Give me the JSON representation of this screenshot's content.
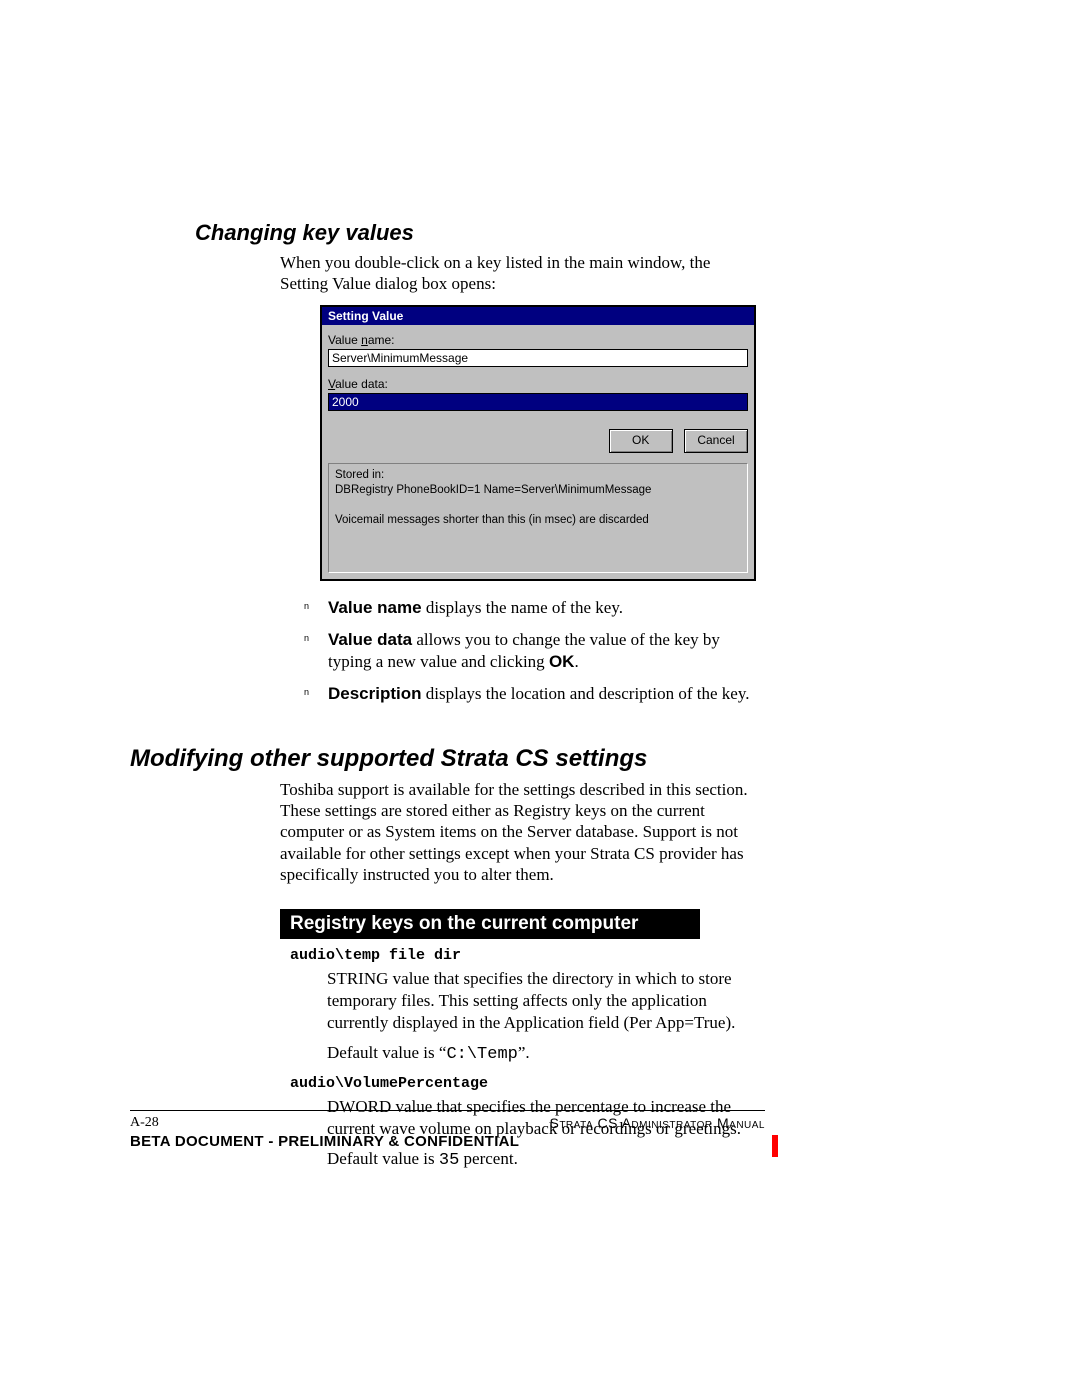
{
  "section1": {
    "heading": "Changing key values",
    "intro": "When you double-click on a key listed in the main window, the Setting Value dialog box opens:"
  },
  "dialog": {
    "title": "Setting Value",
    "value_name_label_pre": "Value ",
    "value_name_label_ul": "n",
    "value_name_label_post": "ame:",
    "value_name": "Server\\MinimumMessage",
    "value_data_label_ul": "V",
    "value_data_label_post": "alue data:",
    "value_data": "2000",
    "ok": "OK",
    "cancel": "Cancel",
    "stored_in_label": "Stored in:",
    "stored_in": "DBRegistry PhoneBookID=1 Name=Server\\MinimumMessage",
    "description": "Voicemail messages shorter than this (in msec) are discarded"
  },
  "bullets": {
    "b1_bold": "Value name",
    "b1_rest": " displays the name of the key.",
    "b2_bold": "Value data",
    "b2_rest1": " allows you to change the value of the key by typing a new value and clicking ",
    "b2_ok": "OK",
    "b2_rest2": ".",
    "b3_bold": "Description",
    "b3_rest": " displays the location and description of the key."
  },
  "section2": {
    "heading": "Modifying other supported Strata CS settings",
    "para": "Toshiba support is available for the settings described in this section. These settings are stored either as Registry keys on the current computer or as System items on the Server database. Support is not available for other settings except when your Strata CS provider has specifically instructed you to alter them."
  },
  "registry": {
    "bar": "Registry keys on the current computer",
    "k1": "audio\\temp file dir",
    "k1_desc": "STRING value that specifies the directory in which to store temporary files. This setting affects only the application currently displayed in the Application field (Per App=True).",
    "k1_default_pre": "Default value is “",
    "k1_default_code": "C:\\Temp",
    "k1_default_post": "”.",
    "k2": "audio\\VolumePercentage",
    "k2_desc": "DWORD value that specifies the percentage to increase the current wave volume on playback or recordings or greetings.",
    "k2_default_pre": "Default value is ",
    "k2_default_code": "35",
    "k2_default_post": " percent."
  },
  "footer": {
    "page": "A-28",
    "manual": "Strata CS Administrator Manual",
    "conf": "BETA DOCUMENT - PRELIMINARY & CONFIDENTIAL"
  }
}
